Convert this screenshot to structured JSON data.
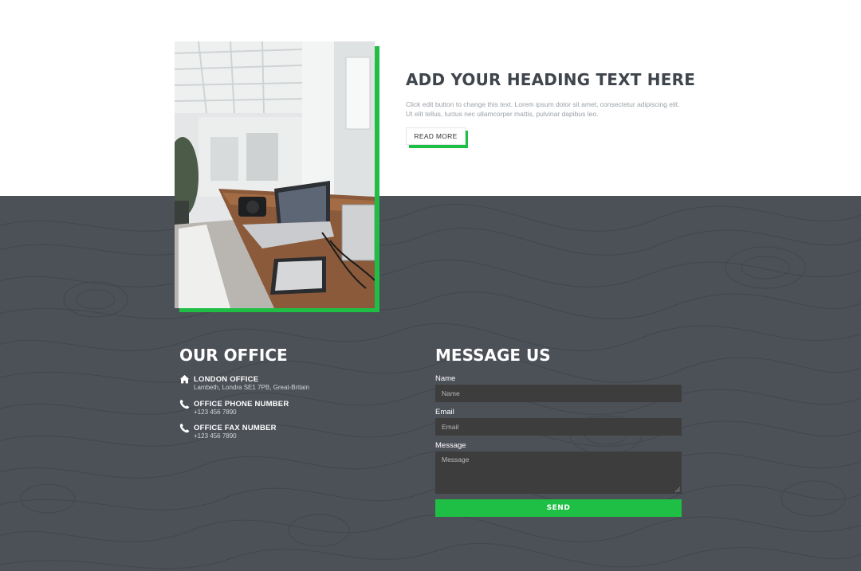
{
  "hero": {
    "heading": "ADD YOUR HEADING TEXT HERE",
    "text": "Click edit button to change this text. Lorem ipsum dolor sit amet, consectetur adipiscing elit. Ut elit tellus, luctus nec ullamcorper mattis, pulvinar dapibus leo.",
    "button_label": "READ MORE"
  },
  "office": {
    "title": "OUR OFFICE",
    "items": [
      {
        "icon": "home-icon",
        "label": "LONDON OFFICE",
        "value": "Lambeth, Londra SE1 7PB, Great-Britain"
      },
      {
        "icon": "phone-icon",
        "label": "OFFICE PHONE NUMBER",
        "value": "+123 456 7890"
      },
      {
        "icon": "phone-icon",
        "label": "OFFICE FAX NUMBER",
        "value": "+123 456 7890"
      }
    ]
  },
  "message": {
    "title": "MESSAGE US",
    "name_label": "Name",
    "name_placeholder": "Name",
    "email_label": "Email",
    "email_placeholder": "Email",
    "message_label": "Message",
    "message_placeholder": "Message",
    "send_label": "SEND"
  },
  "colors": {
    "accent": "#1fbf45",
    "dark_bg": "#4c5057",
    "heading": "#3f454c",
    "input_bg": "#3d3d3d"
  }
}
